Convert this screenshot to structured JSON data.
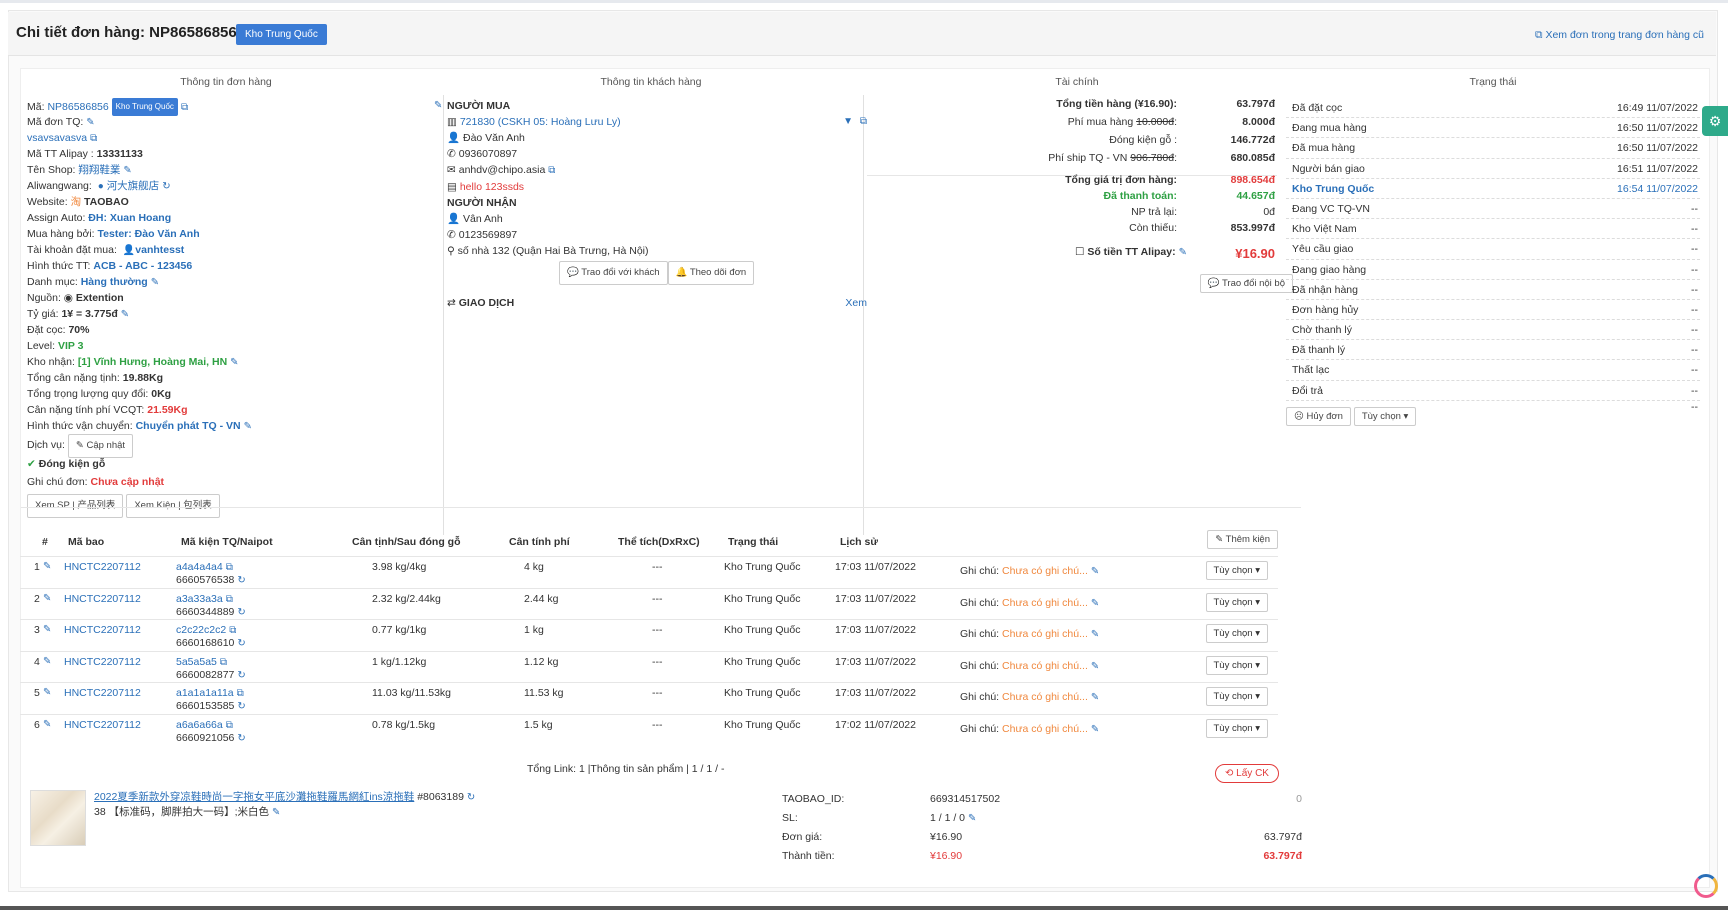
{
  "header": {
    "title": "Chi tiết đơn hàng: NP86586856",
    "badge": "Kho Trung Quốc",
    "old_link": "Xem đơn trong trang đơn hàng cũ"
  },
  "columns": {
    "order_info": "Thông tin đơn hàng",
    "customer_info": "Thông tin khách hàng",
    "finance": "Tài chính",
    "status": "Trạng thái"
  },
  "order": {
    "code_label": "Mã:",
    "code": "NP86586856",
    "code_badge": "Kho Trung Quốc",
    "tq_label": "Mã đơn TQ:",
    "tq_value": "vsavsavasva",
    "alipay_label": "Mã TT Alipay :",
    "alipay_value": "13331133",
    "shop_label": "Tên Shop:",
    "shop_value": "翔翔鞋業",
    "aliwangwang_label": "Aliwangwang:",
    "aliwangwang_value": "河大旗舰店",
    "website_label": "Website:",
    "website_value": "TAOBAO",
    "assign_label": "Assign Auto:",
    "assign_value": "ĐH: Xuan Hoang",
    "buyer_label": "Mua hàng bởi:",
    "buyer_value": "Tester: Đào Văn Anh",
    "account_label": "Tài khoản đặt mua:",
    "account_value": "vanhtesst",
    "payment_label": "Hình thức TT:",
    "payment_value": "ACB - ABC - 123456",
    "category_label": "Danh mục:",
    "category_value": "Hàng thường",
    "source_label": "Nguồn:",
    "source_value": "Extention",
    "rate_label": "Tỷ giá:",
    "rate_value": "1¥ = 3.775đ",
    "deposit_label": "Đặt cọc:",
    "deposit_value": "70%",
    "level_label": "Level:",
    "level_value": "VIP 3",
    "warehouse_label": "Kho nhận:",
    "warehouse_value": "[1] Vĩnh Hưng, Hoàng Mai, HN",
    "weight_label": "Tổng cân nặng tịnh:",
    "weight_value": "19.88Kg",
    "conv_weight_label": "Tổng trọng lượng quy đổi:",
    "conv_weight_value": "0Kg",
    "fee_weight_label": "Cân nặng tính phí VCQT:",
    "fee_weight_value": "21.59Kg",
    "shipping_label": "Hình thức vận chuyển:",
    "shipping_value": "Chuyển phát TQ - VN",
    "service_label": "Dịch vụ:",
    "service_btn": "Cập nhật",
    "wood_pack": "Đóng kiện gỗ",
    "note_label": "Ghi chú đơn:",
    "note_value": "Chưa cập nhật",
    "btn_products": "Xem SP | 产品列表",
    "btn_packages": "Xem Kiện | 包列表"
  },
  "customer": {
    "buyer_title": "NGƯỜI MUA",
    "buyer_id": "721830 (CSKH 05: Hoàng Lưu Ly)",
    "buyer_name": "Đào Văn Anh",
    "buyer_phone": "0936070897",
    "buyer_email": "anhdv@chipo.asia",
    "buyer_note": "hello 123ssds",
    "receiver_title": "NGƯỜI NHẬN",
    "receiver_name": "Vân Anh",
    "receiver_phone": "0123569897",
    "receiver_address": "số nhà 132 (Quận Hai Bà Trưng, Hà Nội)",
    "btn_chat": "Trao đổi với khách",
    "btn_follow": "Theo dõi đơn",
    "transactions": "GIAO DỊCH",
    "view": "Xem"
  },
  "finance": {
    "total_label": "Tổng tiền hàng (¥16.90):",
    "total_value": "63.797đ",
    "buy_fee_label": "Phí mua hàng",
    "buy_fee_strike": "10.000đ",
    "buy_fee_value": "8.000đ",
    "wood_label": "Đóng kiện gỗ :",
    "wood_value": "146.772đ",
    "ship_label": "Phí ship TQ - VN",
    "ship_strike": "906.780đ",
    "ship_value": "680.085đ",
    "order_total_label": "Tổng giá trị đơn hàng:",
    "order_total_value": "898.654đ",
    "paid_label": "Đã thanh toán:",
    "paid_value": "44.657đ",
    "refund_label": "NP trả lại:",
    "refund_value": "0đ",
    "remaining_label": "Còn thiếu:",
    "remaining_value": "853.997đ",
    "alipay_label": "Số tiền TT Alipay:",
    "alipay_value": "¥16.90",
    "internal_btn": "Trao đổi nội bộ"
  },
  "status": {
    "items": [
      {
        "label": "Đã đặt cọc",
        "value": "16:49 11/07/2022"
      },
      {
        "label": "Đang mua hàng",
        "value": "16:50 11/07/2022"
      },
      {
        "label": "Đã mua hàng",
        "value": "16:50 11/07/2022"
      },
      {
        "label": "Người bán giao",
        "value": "16:51 11/07/2022"
      },
      {
        "label": "Kho Trung Quốc",
        "value": "16:54 11/07/2022"
      },
      {
        "label": "Đang VC TQ-VN",
        "value": "--"
      },
      {
        "label": "Kho Việt Nam",
        "value": "--"
      },
      {
        "label": "Yêu cầu giao",
        "value": "--"
      },
      {
        "label": "Đang giao hàng",
        "value": "--"
      },
      {
        "label": "Đã nhận hàng",
        "value": "--"
      },
      {
        "label": "Đơn hàng hủy",
        "value": "--"
      },
      {
        "label": "Chờ thanh lý",
        "value": "--"
      },
      {
        "label": "Đã thanh lý",
        "value": "--"
      },
      {
        "label": "Thất lạc",
        "value": "--"
      },
      {
        "label": "Đổi trả",
        "value": "--"
      }
    ],
    "extra_dash": "--",
    "btn_cancel": "Hủy đơn",
    "btn_options": "Tùy chọn"
  },
  "packages": {
    "headers": [
      "#",
      "Mã bao",
      "Mã kiện TQ/Naipot",
      "Cân tịnh/Sau đóng gỗ",
      "Cân tính phí",
      "Thể tích(DxRxC)",
      "Trạng thái",
      "Lịch sử"
    ],
    "add_btn": "Thêm kiện",
    "note_label": "Ghi chú:",
    "note_value": "Chưa có ghi chú...",
    "option_btn": "Tùy chọn",
    "rows": [
      {
        "num": "1",
        "bag": "HNCTC2207112",
        "code": "a4a4a4a4",
        "naipot": "6660576538",
        "weight": "3.98 kg/4kg",
        "fee": "4 kg",
        "volume": "---",
        "status": "Kho Trung Quốc",
        "time": "17:03 11/07/2022"
      },
      {
        "num": "2",
        "bag": "HNCTC2207112",
        "code": "a3a33a3a",
        "naipot": "6660344889",
        "weight": "2.32 kg/2.44kg",
        "fee": "2.44 kg",
        "volume": "---",
        "status": "Kho Trung Quốc",
        "time": "17:03 11/07/2022"
      },
      {
        "num": "3",
        "bag": "HNCTC2207112",
        "code": "c2c22c2c2",
        "naipot": "6660168610",
        "weight": "0.77 kg/1kg",
        "fee": "1 kg",
        "volume": "---",
        "status": "Kho Trung Quốc",
        "time": "17:03 11/07/2022"
      },
      {
        "num": "4",
        "bag": "HNCTC2207112",
        "code": "5a5a5a5",
        "naipot": "6660082877",
        "weight": "1 kg/1.12kg",
        "fee": "1.12 kg",
        "volume": "---",
        "status": "Kho Trung Quốc",
        "time": "17:03 11/07/2022"
      },
      {
        "num": "5",
        "bag": "HNCTC2207112",
        "code": "a1a1a1a11a",
        "naipot": "6660153585",
        "weight": "11.03 kg/11.53kg",
        "fee": "11.53 kg",
        "volume": "---",
        "status": "Kho Trung Quốc",
        "time": "17:03 11/07/2022"
      },
      {
        "num": "6",
        "bag": "HNCTC2207112",
        "code": "a6a6a66a",
        "naipot": "6660921056",
        "weight": "0.78 kg/1.5kg",
        "fee": "1.5 kg",
        "volume": "---",
        "status": "Kho Trung Quốc",
        "time": "17:02 11/07/2022"
      }
    ]
  },
  "product": {
    "summary": "Tổng Link: 1 |Thông tin sản phẩm | 1 / 1 / -",
    "ck_btn": "Lấy CK",
    "name": "2022夏季新款外穿凉鞋時尚一字拖女平底沙灘拖鞋羅馬網紅ins涼拖鞋",
    "link_id": "#8063189",
    "variant": "38 【标准码，脚胖拍大一码】;米白色",
    "taobao_label": "TAOBAO_ID:",
    "taobao_value": "669314517502",
    "zero": "0",
    "sl_label": "SL:",
    "sl_value": "1 / 1 / 0",
    "price_label": "Đơn giá:",
    "price_cny": "¥16.90",
    "price_vnd": "63.797đ",
    "total_label": "Thành tiền:",
    "total_cny": "¥16.90",
    "total_vnd": "63.797đ"
  }
}
